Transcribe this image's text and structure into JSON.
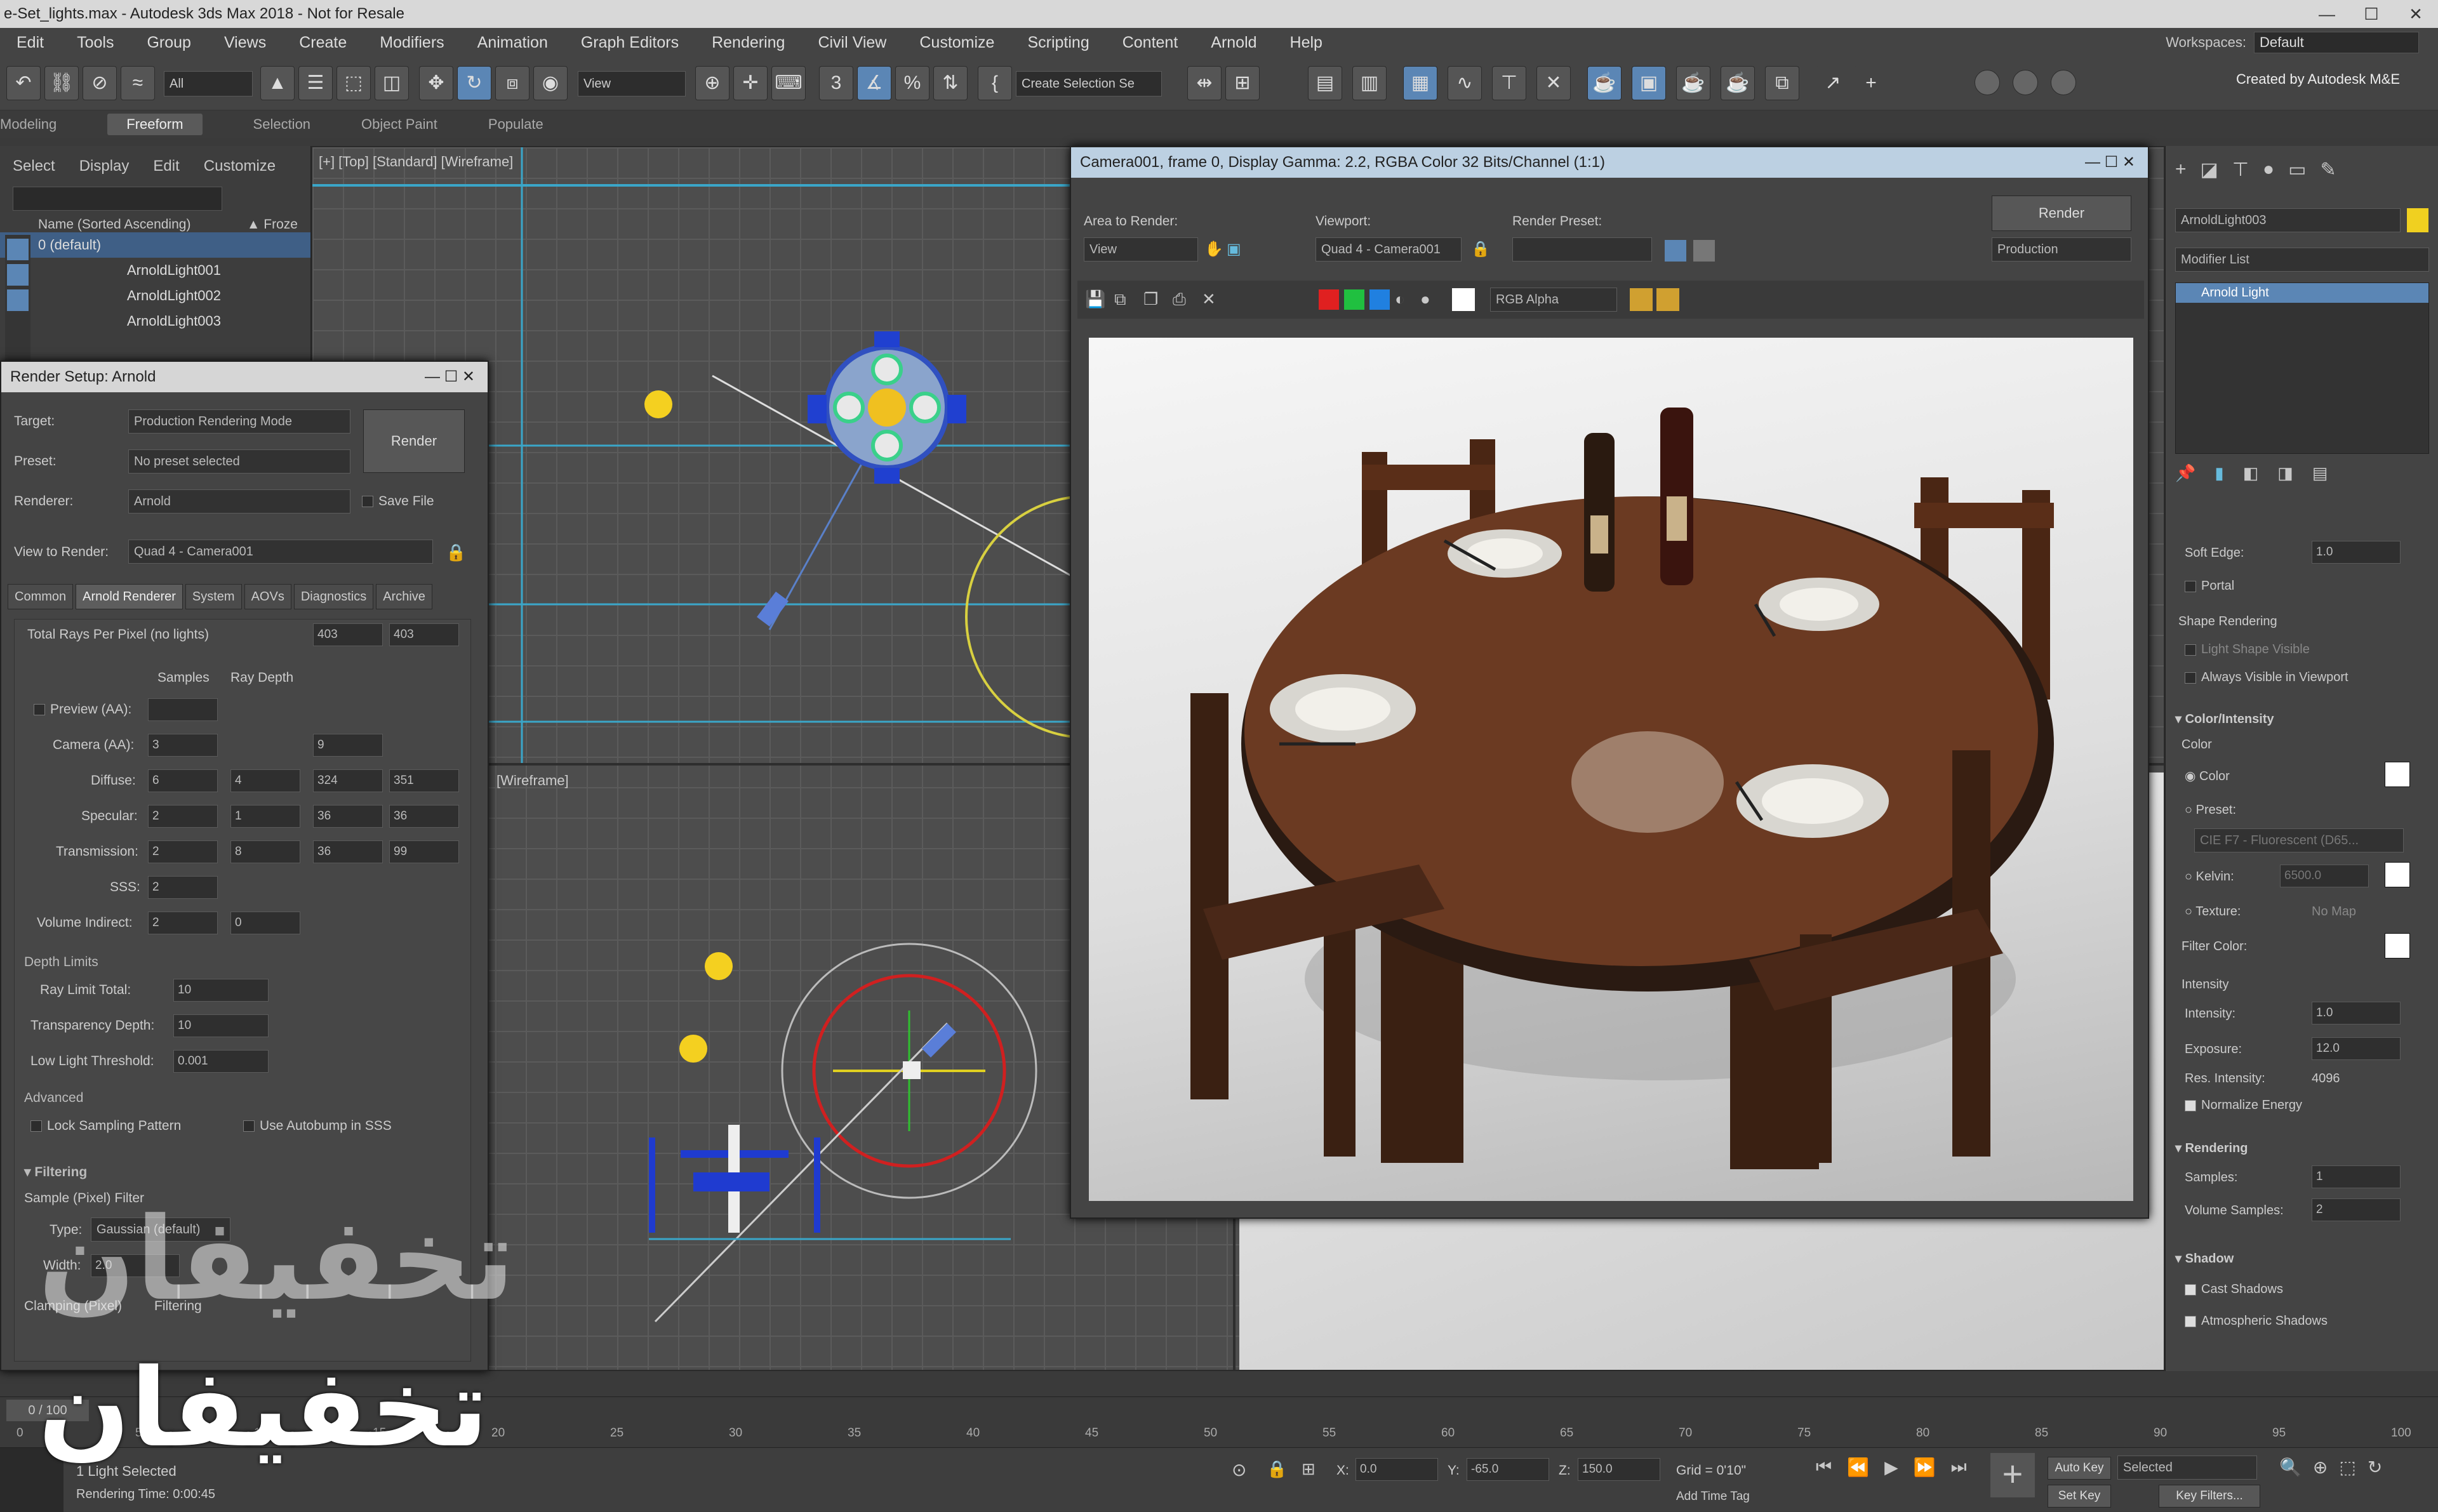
{
  "window": {
    "title": "e-Set_lights.max - Autodesk 3ds Max 2018 - Not for Resale",
    "min": "—",
    "max": "☐",
    "close": "✕"
  },
  "menubar": [
    "Edit",
    "Tools",
    "Group",
    "Views",
    "Create",
    "Modifiers",
    "Animation",
    "Graph Editors",
    "Rendering",
    "Civil View",
    "Customize",
    "Scripting",
    "Content",
    "Arnold",
    "Help"
  ],
  "workspace": {
    "label": "Workspaces:",
    "value": "Default"
  },
  "toolbar": {
    "all_filter": "All",
    "view_select": "View",
    "named_set": "Create Selection Se",
    "credit": "Created by Autodesk M&E"
  },
  "ribbon": [
    "Modeling",
    "Freeform",
    "Selection",
    "Object Paint",
    "Populate"
  ],
  "scene_explorer": {
    "menu": [
      "Select",
      "Display",
      "Edit",
      "Customize"
    ],
    "column": "Name (Sorted Ascending)",
    "column2": "▲ Froze",
    "rows": [
      "0 (default)",
      "ArnoldLight001",
      "ArnoldLight002",
      "ArnoldLight003"
    ]
  },
  "viewport_top": {
    "label": "[+] [Top] [Standard] [Wireframe]"
  },
  "viewport_left": {
    "label": "[Wireframe]"
  },
  "render_setup": {
    "title": "Render Setup: Arnold",
    "target_label": "Target:",
    "target_value": "Production Rendering Mode",
    "preset_label": "Preset:",
    "preset_value": "No preset selected",
    "renderer_label": "Renderer:",
    "renderer_value": "Arnold",
    "savefile": "Save File",
    "view_label": "View to Render:",
    "view_value": "Quad 4 - Camera001",
    "render_btn": "Render",
    "tabs": [
      "Common",
      "Arnold Renderer",
      "System",
      "AOVs",
      "Diagnostics",
      "Archive"
    ],
    "total_rays": "Total Rays Per Pixel (no lights)",
    "total_rays_a": "403",
    "total_rays_b": "403",
    "col_samples": "Samples",
    "col_depth": "Ray Depth",
    "rows": [
      {
        "label": "Preview (AA):",
        "s": "",
        "d": "",
        "a": "",
        "b": ""
      },
      {
        "label": "Camera (AA):",
        "s": "3",
        "d": "",
        "a": "9",
        "b": ""
      },
      {
        "label": "Diffuse:",
        "s": "6",
        "d": "4",
        "a": "324",
        "b": "351"
      },
      {
        "label": "Specular:",
        "s": "2",
        "d": "1",
        "a": "36",
        "b": "36"
      },
      {
        "label": "Transmission:",
        "s": "2",
        "d": "8",
        "a": "36",
        "b": "99"
      },
      {
        "label": "SSS:",
        "s": "2",
        "d": "",
        "a": "",
        "b": ""
      },
      {
        "label": "Volume Indirect:",
        "s": "2",
        "d": "0",
        "a": "",
        "b": ""
      }
    ],
    "depth_title": "Depth Limits",
    "ray_limit_label": "Ray Limit Total:",
    "ray_limit": "10",
    "transp_label": "Transparency Depth:",
    "transp": "10",
    "low_light_label": "Low Light Threshold:",
    "low_light": "0.001",
    "advanced": "Advanced",
    "lock_sampling": "Lock Sampling Pattern",
    "autobump": "Use Autobump in SSS",
    "filtering": "Filtering",
    "sample_filter": "Sample (Pixel) Filter",
    "type_label": "Type:",
    "type_value": "Gaussian (default)",
    "width_label": "Width:",
    "width_value": "2.0",
    "clamping": "Clamping (Pixel)",
    "filtering2": "Filtering"
  },
  "render_frame": {
    "title": "Camera001, frame 0, Display Gamma: 2.2, RGBA Color 32 Bits/Channel (1:1)",
    "area_label": "Area to Render:",
    "area_value": "View",
    "viewport_label": "Viewport:",
    "viewport_value": "Quad 4 - Camera001",
    "preset_label": "Render Preset:",
    "preset_value": "",
    "render_btn": "Render",
    "production": "Production",
    "channel": "RGB Alpha"
  },
  "command_panel": {
    "object_name": "ArnoldLight003",
    "modifier_list": "Modifier List",
    "stack_item": "Arnold Light",
    "soft_edge_label": "Soft Edge:",
    "soft_edge": "1.0",
    "portal": "Portal",
    "shape_rendering": "Shape Rendering",
    "light_shape_visible": "Light Shape Visible",
    "always_visible": "Always Visible in Viewport",
    "color_intensity": "Color/Intensity",
    "color_title": "Color",
    "color_opt": "Color",
    "preset_opt": "Preset:",
    "preset_value": "CIE F7 - Fluorescent (D65...",
    "kelvin_opt": "Kelvin:",
    "kelvin_value": "6500.0",
    "texture_opt": "Texture:",
    "texture_value": "No Map",
    "filter_color": "Filter Color:",
    "intensity_title": "Intensity",
    "intensity_label": "Intensity:",
    "intensity": "1.0",
    "exposure_label": "Exposure:",
    "exposure": "12.0",
    "res_intensity_label": "Res. Intensity:",
    "res_intensity": "4096",
    "normalize": "Normalize Energy",
    "rendering_title": "Rendering",
    "samples_label": "Samples:",
    "samples": "1",
    "vol_samples_label": "Volume Samples:",
    "vol_samples": "2",
    "shadow_title": "Shadow",
    "cast_shadows": "Cast Shadows",
    "atmo_shadows": "Atmospheric Shadows"
  },
  "timeline": {
    "frame": "0 / 100",
    "ticks": [
      "0",
      "5",
      "10",
      "15",
      "20",
      "25",
      "30",
      "35",
      "40",
      "45",
      "50",
      "55",
      "60",
      "65",
      "70",
      "75",
      "80",
      "85",
      "90",
      "95",
      "100"
    ]
  },
  "status": {
    "selected": "1 Light Selected",
    "render_time": "Rendering Time: 0:00:45",
    "x_label": "X:",
    "x": "0.0",
    "y_label": "Y:",
    "y": "-65.0",
    "z_label": "Z:",
    "z": "150.0",
    "grid": "Grid = 0'10\"",
    "add_time_tag": "Add Time Tag",
    "autokey": "Auto Key",
    "selected_dd": "Selected",
    "setkey": "Set Key",
    "keyfilters": "Key Filters..."
  },
  "watermark": {
    "text": "تخفیفان"
  }
}
